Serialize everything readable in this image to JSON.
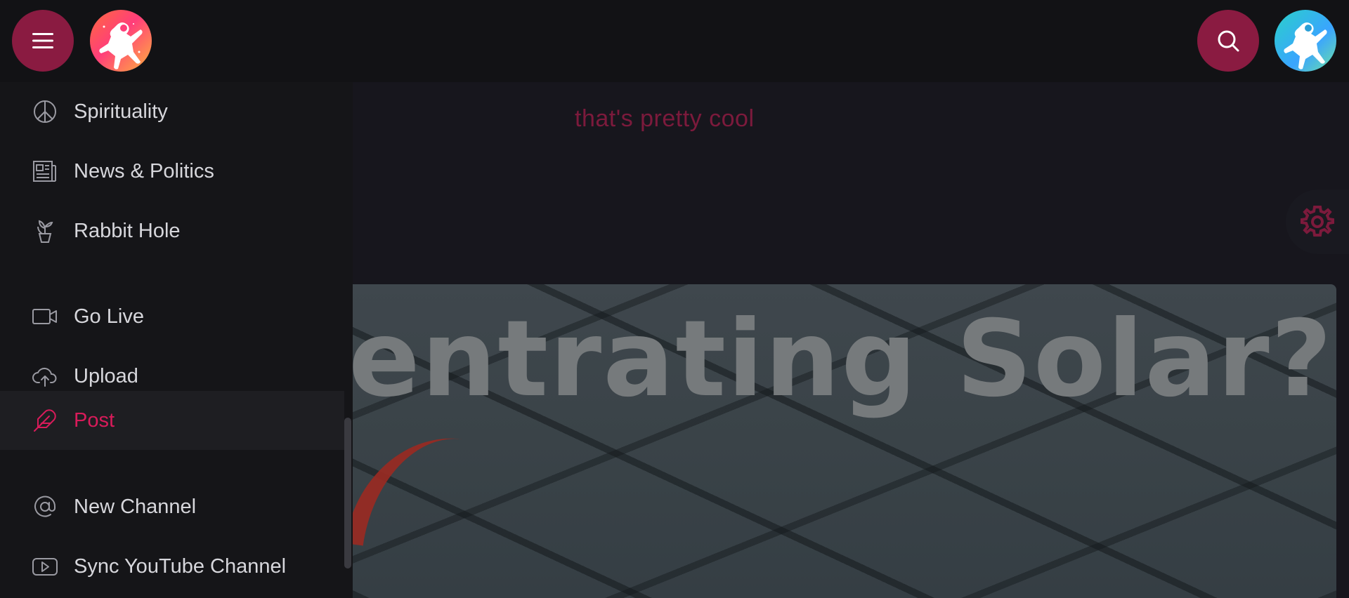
{
  "header": {
    "menu_icon": "hamburger-icon",
    "logo_icon": "astronaut-logo-icon",
    "search_icon": "search-icon",
    "user_avatar_icon": "astronaut-avatar-icon"
  },
  "colors": {
    "accent": "#8a1b41",
    "active_text": "#d81b5a",
    "background": "#121215"
  },
  "sidebar": {
    "items": [
      {
        "label": "Spirituality",
        "icon": "peace-icon"
      },
      {
        "label": "News & Politics",
        "icon": "newspaper-icon"
      },
      {
        "label": "Rabbit Hole",
        "icon": "plant-icon"
      },
      {
        "label": "Go Live",
        "icon": "video-camera-icon"
      },
      {
        "label": "Upload",
        "icon": "cloud-upload-icon"
      },
      {
        "label": "Post",
        "icon": "feather-icon",
        "active": true
      },
      {
        "label": "New Channel",
        "icon": "at-sign-icon"
      },
      {
        "label": "Sync YouTube Channel",
        "icon": "youtube-icon"
      }
    ]
  },
  "main": {
    "comment_text": "that's pretty cool",
    "thumbnail_title": "entrating Solar?",
    "settings_icon": "gear-icon"
  }
}
